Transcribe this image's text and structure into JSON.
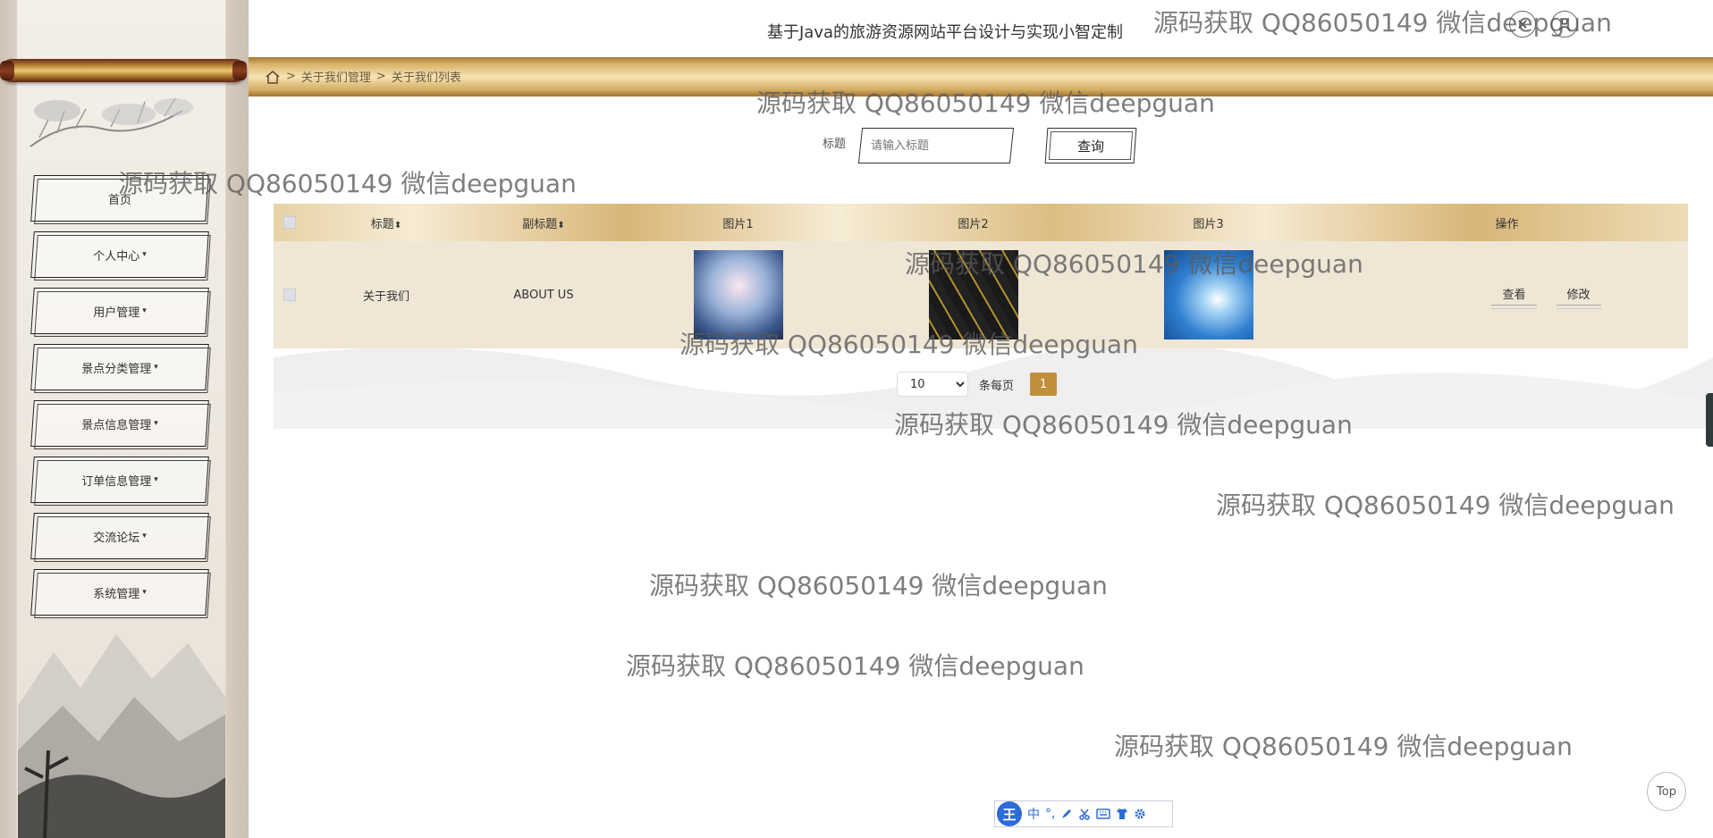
{
  "header": {
    "site_title": "基于Java的旅游资源网站平台设计与实现小智定制",
    "close_icon": "close-icon",
    "user_icon": "user-icon"
  },
  "breadcrumb": {
    "sep1": ">",
    "item1": "关于我们管理",
    "sep2": ">",
    "item2": "关于我们列表"
  },
  "sidebar": {
    "items": [
      {
        "label": "首页",
        "caret": ""
      },
      {
        "label": "个人中心",
        "caret": "▾"
      },
      {
        "label": "用户管理",
        "caret": "▾"
      },
      {
        "label": "景点分类管理",
        "caret": "▾"
      },
      {
        "label": "景点信息管理",
        "caret": "▾"
      },
      {
        "label": "订单信息管理",
        "caret": "▾"
      },
      {
        "label": "交流论坛",
        "caret": "▾"
      },
      {
        "label": "系统管理",
        "caret": "▾"
      }
    ]
  },
  "search": {
    "label": "标题",
    "placeholder": "请输入标题",
    "button_label": "查询"
  },
  "table": {
    "headers": {
      "title": "标题",
      "subtitle": "副标题",
      "image1": "图片1",
      "image2": "图片2",
      "image3": "图片3",
      "actions": "操作",
      "sort_icon": "⬍"
    },
    "rows": [
      {
        "title": "关于我们",
        "subtitle": "ABOUT US",
        "view_label": "查看",
        "edit_label": "修改"
      }
    ]
  },
  "pagination": {
    "page_size": "10",
    "page_size_options": [
      "10"
    ],
    "per_page_label": "条每页",
    "current_page": "1"
  },
  "watermark_text": "源码获取 QQ86050149 微信deepguan",
  "top_button_label": "Top",
  "ime": {
    "logo": "王",
    "mode": "中",
    "symbols": "°,",
    "icons": [
      "pen-icon",
      "scissors-icon",
      "keyboard-icon",
      "shirt-icon",
      "gear-icon"
    ]
  },
  "colors": {
    "gold_band": "#d9b36a",
    "page_button": "#c28f3c",
    "row_bg": "#efe6d6"
  }
}
